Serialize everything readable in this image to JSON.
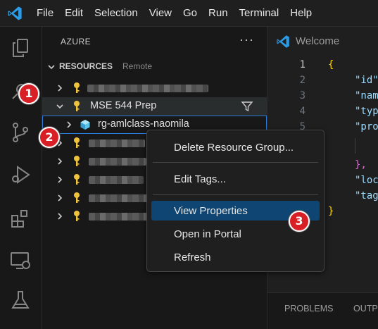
{
  "menu": [
    "File",
    "Edit",
    "Selection",
    "View",
    "Go",
    "Run",
    "Terminal",
    "Help"
  ],
  "sidebar": {
    "title": "AZURE",
    "more_label": "···",
    "section_title": "RESOURCES",
    "section_subtitle": "Remote",
    "subscription_label": "MSE 544 Prep",
    "resource_group_label": "rg-amlclass-naomila"
  },
  "editor": {
    "tab_label": "Welcome",
    "line_numbers": [
      "1",
      "2",
      "3",
      "4",
      "5"
    ],
    "code": {
      "open_brace": "{",
      "id": "\"id\"",
      "name": "\"nam",
      "type": "\"typ",
      "properties": "\"pro",
      "close_obj": "},",
      "location": "\"loc",
      "tags": "\"tag",
      "close_brace": "}"
    }
  },
  "panel": {
    "tabs": [
      "PROBLEMS",
      "OUTP"
    ]
  },
  "context_menu": {
    "items": [
      "Delete Resource Group...",
      "Edit Tags...",
      "View Properties",
      "Open in Portal",
      "Refresh"
    ],
    "selected": "View Properties"
  },
  "callouts": [
    "1",
    "2",
    "3"
  ],
  "colors": {
    "accent_vscode": "#2c9ce6",
    "key_icon": "#f0c33c",
    "callout_red": "#d81f26",
    "menu_selected": "#0e4572"
  }
}
